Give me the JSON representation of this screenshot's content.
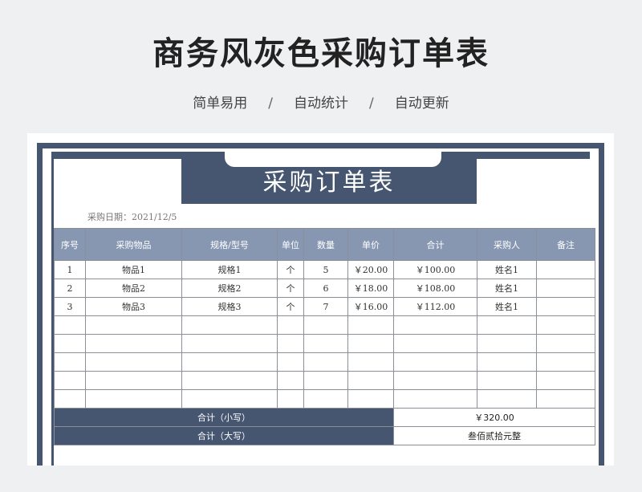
{
  "header": {
    "title": "商务风灰色采购订单表",
    "tags": [
      "简单易用",
      "自动统计",
      "自动更新"
    ],
    "separator": "/"
  },
  "form": {
    "title": "采购订单表",
    "date_label": "采购日期：2021/12/5"
  },
  "table": {
    "columns": [
      "序号",
      "采购物品",
      "规格/型号",
      "单位",
      "数量",
      "单价",
      "合计",
      "采购人",
      "备注"
    ],
    "rows": [
      [
        "1",
        "物品1",
        "规格1",
        "个",
        "5",
        "￥20.00",
        "￥100.00",
        "姓名1",
        ""
      ],
      [
        "2",
        "物品2",
        "规格2",
        "个",
        "6",
        "￥18.00",
        "￥108.00",
        "姓名1",
        ""
      ],
      [
        "3",
        "物品3",
        "规格3",
        "个",
        "7",
        "￥16.00",
        "￥112.00",
        "姓名1",
        ""
      ],
      [
        "",
        "",
        "",
        "",
        "",
        "",
        "",
        "",
        ""
      ],
      [
        "",
        "",
        "",
        "",
        "",
        "",
        "",
        "",
        ""
      ],
      [
        "",
        "",
        "",
        "",
        "",
        "",
        "",
        "",
        ""
      ],
      [
        "",
        "",
        "",
        "",
        "",
        "",
        "",
        "",
        ""
      ],
      [
        "",
        "",
        "",
        "",
        "",
        "",
        "",
        "",
        ""
      ]
    ]
  },
  "totals": {
    "small_label": "合计（小写）",
    "small_value": "￥320.00",
    "big_label": "合计（大写）",
    "big_value": "叁佰贰拾元整"
  },
  "colors": {
    "frame": "#465570",
    "header_fill": "#8797b2",
    "background": "#eef0f2"
  }
}
